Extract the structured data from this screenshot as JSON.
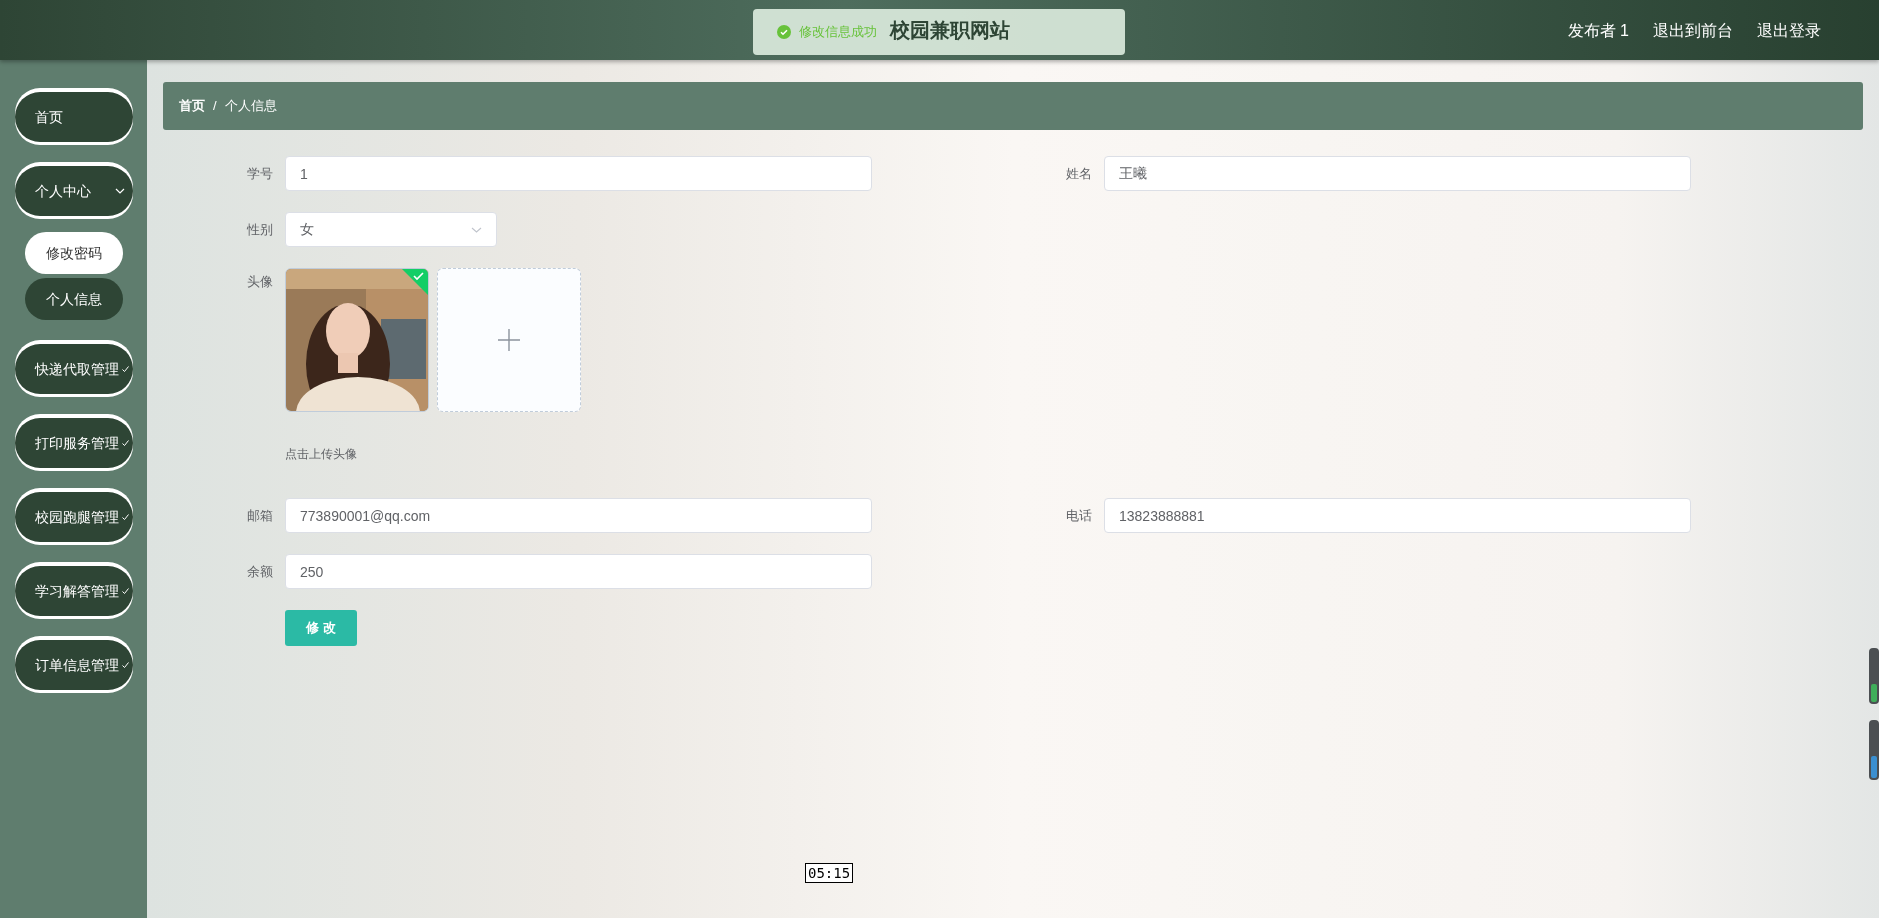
{
  "header": {
    "title": "校园兼职网站",
    "links": [
      "发布者 1",
      "退出到前台",
      "退出登录"
    ]
  },
  "toast": {
    "kind": "success",
    "message": "修改信息成功"
  },
  "sidebar": {
    "items": [
      {
        "label": "首页",
        "kind": "link",
        "selected": false
      },
      {
        "label": "个人中心",
        "kind": "group",
        "expanded": true,
        "selected": false,
        "children": [
          {
            "label": "修改密码",
            "selected": true
          },
          {
            "label": "个人信息",
            "selected": false
          }
        ]
      },
      {
        "label": "快递代取管理",
        "kind": "group",
        "expanded": false,
        "selected": false
      },
      {
        "label": "打印服务管理",
        "kind": "group",
        "expanded": false,
        "selected": false
      },
      {
        "label": "校园跑腿管理",
        "kind": "group",
        "expanded": false,
        "selected": false
      },
      {
        "label": "学习解答管理",
        "kind": "group",
        "expanded": false,
        "selected": false
      },
      {
        "label": "订单信息管理",
        "kind": "group",
        "expanded": false,
        "selected": false
      }
    ]
  },
  "breadcrumb": [
    "首页",
    "个人信息"
  ],
  "breadcrumb_separator": "/",
  "form": {
    "fields": [
      {
        "label": "学号",
        "kind": "text",
        "value": "1"
      },
      {
        "label": "姓名",
        "kind": "text",
        "value": "王曦"
      },
      {
        "label": "性别",
        "kind": "select",
        "value": "女"
      },
      {
        "label": "头像",
        "kind": "upload",
        "uploaded": true,
        "hint": "点击上传头像"
      },
      {
        "label": "邮箱",
        "kind": "text",
        "value": "773890001@qq.com"
      },
      {
        "label": "电话",
        "kind": "text",
        "value": "13823888881"
      },
      {
        "label": "余额",
        "kind": "text",
        "value": "250"
      }
    ],
    "submit": "修 改"
  },
  "tooltip": "05:15",
  "side_meters": [
    {
      "level": 0.35,
      "color": "#3fae5a"
    },
    {
      "level": 0.4,
      "color": "#3a8fd0"
    }
  ]
}
